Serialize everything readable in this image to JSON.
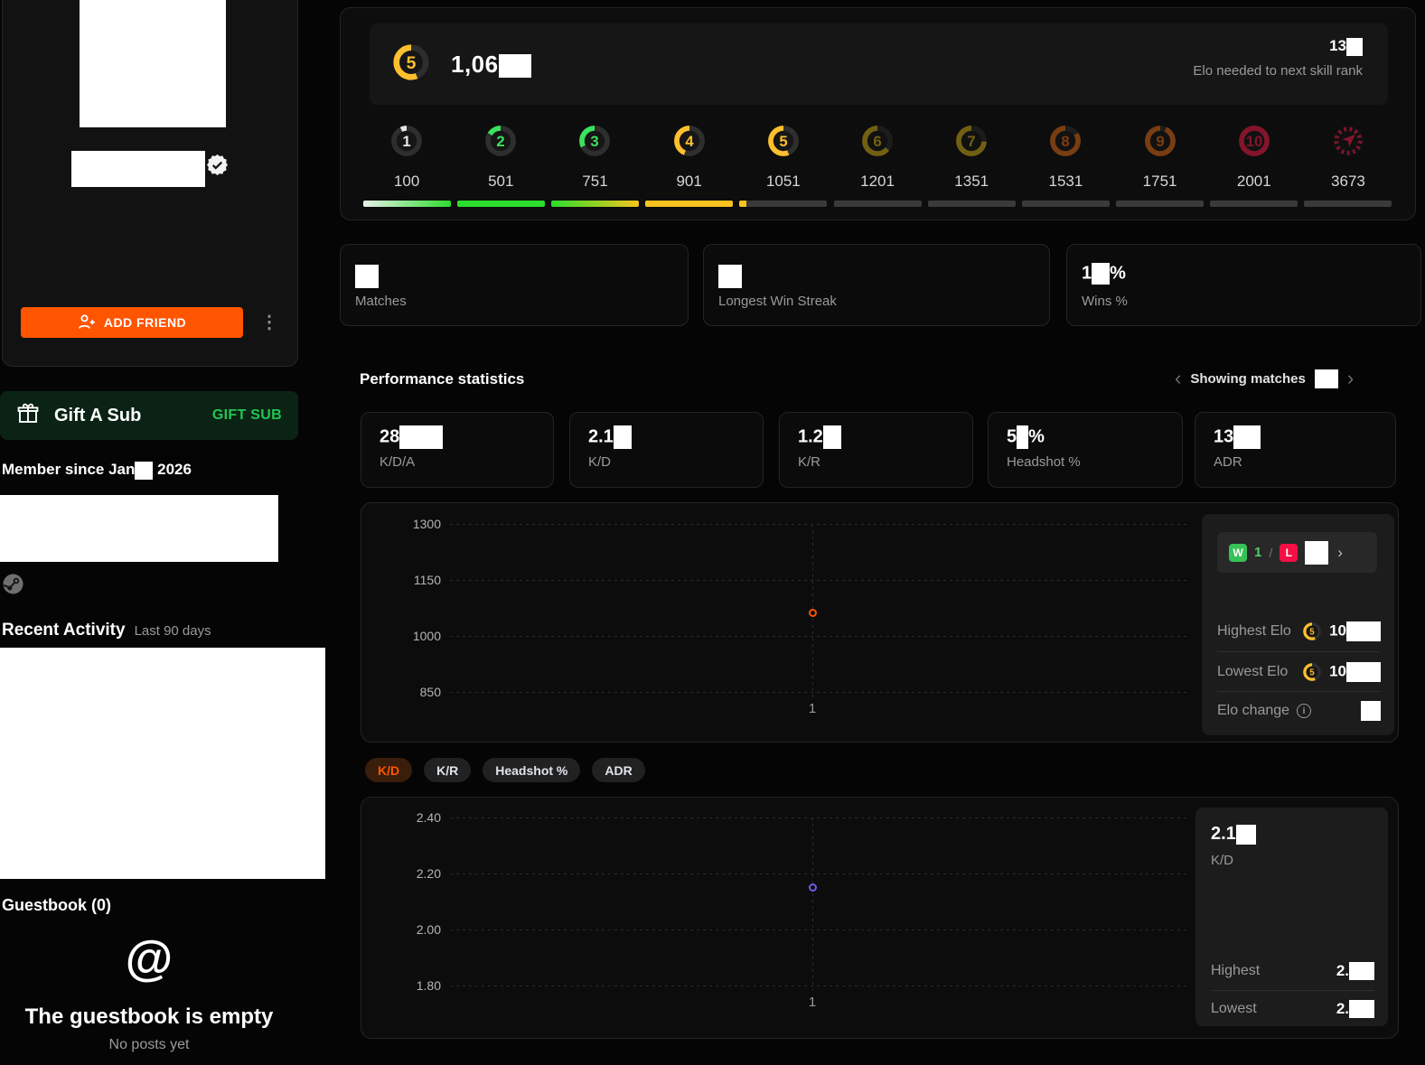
{
  "colors": {
    "accent": "#ff5500",
    "win": "#35c257",
    "loss": "#f50f44",
    "gold": "#fdbf2d",
    "gift_green": "#23c552"
  },
  "icons": {
    "kebab": "⋮",
    "chevron_left": "‹",
    "chevron_right": "›",
    "wl_chevron": "›",
    "at": "@",
    "info": "i",
    "names": [
      "person-add-icon",
      "kebab-icon",
      "gift-icon",
      "verified-badge-icon",
      "steam-icon",
      "at-icon",
      "info-icon",
      "level-gauge-icon",
      "challenger-laurel-icon"
    ]
  },
  "sidebar": {
    "add_friend_label": "ADD FRIEND",
    "gift_title": "Gift A Sub",
    "gift_button": "GIFT SUB",
    "member_since": "Member since Jan",
    "member_year": "2026",
    "recent_activity": "Recent Activity",
    "recent_range": "Last 90 days",
    "guestbook": "Guestbook (0)",
    "guestbook_empty": "The guestbook is empty",
    "guestbook_sub": "No posts yet"
  },
  "elo_header": {
    "level": "5",
    "elo_visible": "1,06",
    "needed_visible": "13",
    "needed_label": "Elo needed to next skill rank"
  },
  "ladder": {
    "levels": [
      {
        "n": "1",
        "elo": "100",
        "color": "#e6e6e6",
        "frac": 0.07,
        "dim": false
      },
      {
        "n": "2",
        "elo": "501",
        "color": "#3be25b",
        "frac": 0.16,
        "dim": false
      },
      {
        "n": "3",
        "elo": "751",
        "color": "#3be25b",
        "frac": 0.32,
        "dim": false
      },
      {
        "n": "4",
        "elo": "901",
        "color": "#fdbf2d",
        "frac": 0.44,
        "dim": false
      },
      {
        "n": "5",
        "elo": "1051",
        "color": "#fdbf2d",
        "frac": 0.56,
        "dim": false
      },
      {
        "n": "6",
        "elo": "1201",
        "color": "#d6b217",
        "frac": 0.64,
        "dim": true
      },
      {
        "n": "7",
        "elo": "1351",
        "color": "#d6b217",
        "frac": 0.74,
        "dim": true
      },
      {
        "n": "8",
        "elo": "1531",
        "color": "#e56d17",
        "frac": 0.84,
        "dim": true
      },
      {
        "n": "9",
        "elo": "1751",
        "color": "#e56d17",
        "frac": 0.93,
        "dim": true
      },
      {
        "n": "10",
        "elo": "2001",
        "color": "#fb1c49",
        "frac": 1.0,
        "dim": true
      },
      {
        "n": "max",
        "elo": "3673",
        "color": "#fb1c49",
        "frac": 1.0,
        "dim": true,
        "challenger": true
      }
    ]
  },
  "summary_cards": [
    {
      "label": "Matches"
    },
    {
      "label": "Longest Win Streak"
    },
    {
      "label": "Wins %",
      "value_prefix": "1",
      "value_suffix": "%"
    }
  ],
  "performance": {
    "title": "Performance statistics",
    "showing_label": "Showing matches",
    "stats": [
      {
        "value": "28",
        "suffix": "",
        "label": "K/D/A"
      },
      {
        "value": "2.1",
        "suffix": "",
        "label": "K/D"
      },
      {
        "value": "1.2",
        "suffix": "",
        "label": "K/R"
      },
      {
        "value": "5",
        "suffix": "%",
        "label": "Headshot %"
      },
      {
        "value": "13",
        "suffix": "",
        "label": "ADR"
      }
    ]
  },
  "chart_data": [
    {
      "type": "scatter",
      "title": "Elo history",
      "x": [
        1
      ],
      "xticks": [
        "1"
      ],
      "series": [
        {
          "name": "Elo",
          "values": [
            1061
          ]
        }
      ],
      "yticks": [
        "1300",
        "1150",
        "1000",
        "850"
      ],
      "ylim": [
        850,
        1300
      ],
      "grid": "dashed",
      "legend_position": "none",
      "point_color": "#ff5500"
    },
    {
      "type": "scatter",
      "title": "K/D history",
      "x": [
        1
      ],
      "xticks": [
        "1"
      ],
      "series": [
        {
          "name": "K/D",
          "values": [
            2.15
          ]
        }
      ],
      "yticks": [
        "2.40",
        "2.20",
        "2.00",
        "1.80"
      ],
      "ylim": [
        1.8,
        2.4
      ],
      "grid": "dashed",
      "legend_position": "none",
      "point_color": "#6c5ce7"
    }
  ],
  "elo_panel": {
    "w_label": "W",
    "wins": "1",
    "slash": "/",
    "l_label": "L",
    "highest_label": "Highest Elo",
    "highest_visible": "10",
    "lowest_label": "Lowest Elo",
    "lowest_visible": "10",
    "change_label": "Elo change"
  },
  "tabs": [
    {
      "label": "K/D",
      "active": true
    },
    {
      "label": "K/R",
      "active": false
    },
    {
      "label": "Headshot %",
      "active": false
    },
    {
      "label": "ADR",
      "active": false
    }
  ],
  "kd_panel": {
    "value": "2.1",
    "label": "K/D",
    "highest_label": "Highest",
    "highest_visible": "2.",
    "lowest_label": "Lowest",
    "lowest_visible": "2."
  }
}
